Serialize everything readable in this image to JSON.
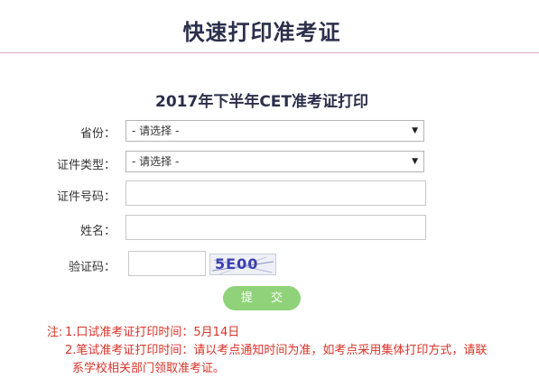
{
  "header": {
    "title": "快速打印准考证"
  },
  "form": {
    "title": "2017年下半年CET准考证打印",
    "fields": {
      "province": {
        "label": "省份：",
        "value": "- 请选择 -"
      },
      "id_type": {
        "label": "证件类型：",
        "value": "- 请选择 -"
      },
      "id_number": {
        "label": "证件号码：",
        "value": ""
      },
      "name": {
        "label": "姓名：",
        "value": ""
      },
      "captcha": {
        "label": "验证码：",
        "value": "",
        "image_text": "5E00"
      }
    },
    "submit_label": "提 交"
  },
  "notes": {
    "prefix": "注:",
    "line1": "1.口试准考证打印时间：5月14日",
    "line2": "2.笔试准考证打印时间：请以考点通知时间为准，如考点采用集体打印方式，请联",
    "line3": "系学校相关部门领取准考证。"
  },
  "colors": {
    "title": "#2b2f4a",
    "divider": "#d3a9c4",
    "submit_button": "#8fd27a",
    "note_text": "#d8332a",
    "captcha_text": "#3b3fb0"
  }
}
